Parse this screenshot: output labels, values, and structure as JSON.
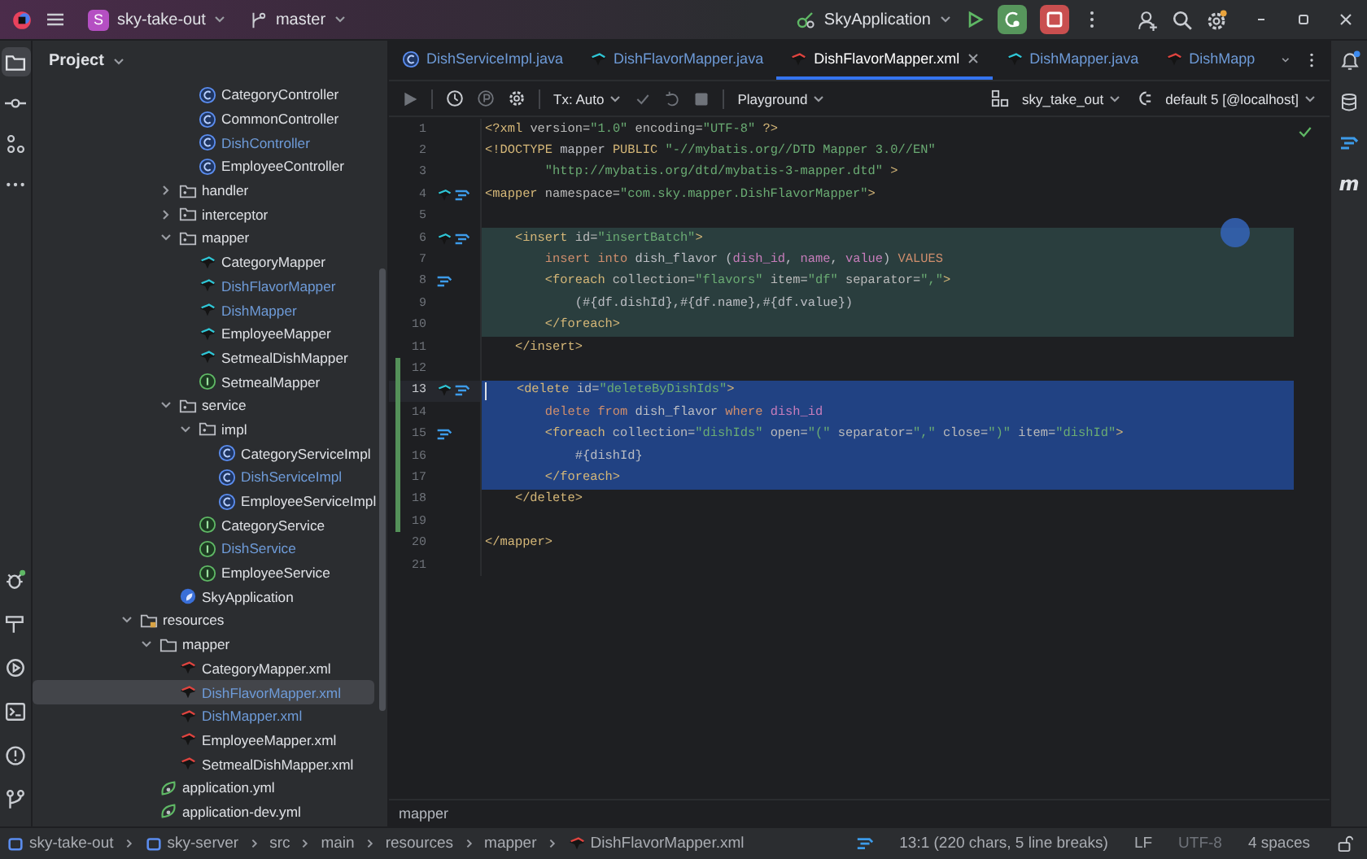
{
  "title_bar": {
    "project_badge": "S",
    "project": "sky-take-out",
    "branch": "master",
    "run_config": "SkyApplication"
  },
  "left_tools": [
    {
      "kind": "project",
      "selected": true
    },
    {
      "kind": "commit",
      "selected": false
    },
    {
      "kind": "structure",
      "selected": false
    },
    {
      "kind": "more",
      "selected": false
    }
  ],
  "left_tools_bottom": [
    {
      "kind": "debug",
      "selected": false
    },
    {
      "kind": "build",
      "selected": false
    },
    {
      "kind": "services",
      "selected": false
    },
    {
      "kind": "terminal",
      "selected": false
    },
    {
      "kind": "problems",
      "selected": false
    },
    {
      "kind": "git",
      "selected": false
    }
  ],
  "project_panel": {
    "title": "Project",
    "tree": [
      {
        "children": [
          {
            "children": [
              {
                "children": [
                  {
                    "name": "CategoryController",
                    "kind": "class",
                    "modified": false,
                    "selected": false
                  },
                  {
                    "name": "CommonController",
                    "kind": "class",
                    "modified": false,
                    "selected": false
                  },
                  {
                    "name": "DishController",
                    "kind": "class",
                    "modified": true,
                    "selected": false
                  },
                  {
                    "name": "EmployeeController",
                    "kind": "class",
                    "modified": false,
                    "selected": false
                  }
                ]
              },
              {
                "name": "handler",
                "kind": "package",
                "expanded": false,
                "modified": false,
                "selected": false
              },
              {
                "name": "interceptor",
                "kind": "package",
                "expanded": false,
                "modified": false,
                "selected": false
              },
              {
                "name": "mapper",
                "kind": "package",
                "expanded": true,
                "modified": false,
                "selected": false,
                "children": [
                  {
                    "name": "CategoryMapper",
                    "kind": "mapper",
                    "modified": false,
                    "selected": false
                  },
                  {
                    "name": "DishFlavorMapper",
                    "kind": "mapper",
                    "modified": true,
                    "selected": false
                  },
                  {
                    "name": "DishMapper",
                    "kind": "mapper",
                    "modified": true,
                    "selected": false
                  },
                  {
                    "name": "EmployeeMapper",
                    "kind": "mapper",
                    "modified": false,
                    "selected": false
                  },
                  {
                    "name": "SetmealDishMapper",
                    "kind": "mapper",
                    "modified": false,
                    "selected": false
                  },
                  {
                    "name": "SetmealMapper",
                    "kind": "interface",
                    "modified": false,
                    "selected": false
                  }
                ]
              },
              {
                "name": "service",
                "kind": "package",
                "expanded": true,
                "modified": false,
                "selected": false,
                "children": [
                  {
                    "name": "impl",
                    "kind": "package",
                    "expanded": true,
                    "modified": false,
                    "selected": false,
                    "children": [
                      {
                        "name": "CategoryServiceImpl",
                        "kind": "class",
                        "modified": false,
                        "selected": false
                      },
                      {
                        "name": "DishServiceImpl",
                        "kind": "class",
                        "modified": true,
                        "selected": false
                      },
                      {
                        "name": "EmployeeServiceImpl",
                        "kind": "class",
                        "modified": false,
                        "selected": false
                      }
                    ]
                  },
                  {
                    "name": "CategoryService",
                    "kind": "interface",
                    "modified": false,
                    "selected": false
                  },
                  {
                    "name": "DishService",
                    "kind": "interface",
                    "modified": true,
                    "selected": false
                  },
                  {
                    "name": "EmployeeService",
                    "kind": "interface",
                    "modified": false,
                    "selected": false
                  }
                ]
              },
              {
                "name": "SkyApplication",
                "kind": "app",
                "modified": false,
                "selected": false
              }
            ]
          }
        ]
      },
      {
        "name": "resources",
        "kind": "resources-folder",
        "expanded": true,
        "modified": false,
        "selected": false,
        "children": [
          {
            "name": "mapper",
            "kind": "folder",
            "expanded": true,
            "modified": false,
            "selected": false,
            "children": [
              {
                "name": "CategoryMapper.xml",
                "kind": "xml",
                "modified": false,
                "selected": false
              },
              {
                "name": "DishFlavorMapper.xml",
                "kind": "xml",
                "modified": true,
                "selected": true
              },
              {
                "name": "DishMapper.xml",
                "kind": "xml",
                "modified": true,
                "selected": false
              },
              {
                "name": "EmployeeMapper.xml",
                "kind": "xml",
                "modified": false,
                "selected": false
              },
              {
                "name": "SetmealDishMapper.xml",
                "kind": "xml",
                "modified": false,
                "selected": false
              }
            ]
          },
          {
            "name": "application.yml",
            "kind": "yml",
            "modified": false,
            "selected": false
          },
          {
            "name": "application-dev.yml",
            "kind": "yml",
            "modified": false,
            "selected": false
          }
        ]
      }
    ]
  },
  "editor": {
    "tabs": [
      {
        "name": "DishServiceImpl.java",
        "kind": "class",
        "modified": true,
        "selected": false
      },
      {
        "name": "DishFlavorMapper.java",
        "kind": "mapper",
        "modified": true,
        "selected": false
      },
      {
        "name": "DishFlavorMapper.xml",
        "kind": "xml",
        "modified": false,
        "selected": true
      },
      {
        "name": "DishMapper.java",
        "kind": "mapper",
        "modified": true,
        "selected": false
      },
      {
        "name": "DishMapp",
        "kind": "xml",
        "modified": true,
        "selected": false
      }
    ],
    "toolbar": {
      "tx": "Tx: Auto",
      "playground": "Playground",
      "schema": "sky_take_out",
      "datasource": "default 5 [@localhost]"
    },
    "lines": [
      {
        "number": "1",
        "current": false,
        "changed": false,
        "selected": false,
        "in_scope": false,
        "segments": [
          {
            "kind": "tag",
            "text": "<?xml"
          },
          {
            "kind": "attr",
            "text": " version="
          },
          {
            "kind": "str",
            "text": "\"1.0\""
          },
          {
            "kind": "attr",
            "text": " encoding="
          },
          {
            "kind": "str",
            "text": "\"UTF-8\""
          },
          {
            "kind": "tag",
            "text": " ?>"
          }
        ]
      },
      {
        "number": "2",
        "current": false,
        "changed": false,
        "selected": false,
        "in_scope": false,
        "segments": [
          {
            "kind": "tag",
            "text": "<!DOCTYPE"
          },
          {
            "kind": "txt",
            "text": " mapper "
          },
          {
            "kind": "tag",
            "text": "PUBLIC"
          },
          {
            "kind": "str",
            "text": " \"-//mybatis.org//DTD Mapper 3.0//EN\""
          }
        ]
      },
      {
        "number": "3",
        "current": false,
        "changed": false,
        "selected": false,
        "in_scope": false,
        "segments": [
          {
            "kind": "str",
            "text": "        \"http://mybatis.org/dtd/mybatis-3-mapper.dtd\""
          },
          {
            "kind": "tag",
            "text": " >"
          }
        ]
      },
      {
        "number": "4",
        "current": false,
        "changed": false,
        "selected": false,
        "in_scope": false,
        "markers": [
          {
            "kind": "mapper"
          },
          {
            "kind": "jump"
          }
        ],
        "segments": [
          {
            "kind": "tag",
            "text": "<mapper"
          },
          {
            "kind": "attr",
            "text": " namespace="
          },
          {
            "kind": "str",
            "text": "\"com.sky.mapper.DishFlavorMapper\""
          },
          {
            "kind": "tag",
            "text": ">"
          }
        ]
      },
      {
        "number": "5",
        "current": false,
        "changed": false,
        "selected": false,
        "in_scope": false
      },
      {
        "number": "6",
        "current": false,
        "changed": false,
        "selected": false,
        "in_scope": true,
        "markers": [
          {
            "kind": "mapper"
          },
          {
            "kind": "jump"
          }
        ],
        "segments": [
          {
            "kind": "tag",
            "text": "    <insert"
          },
          {
            "kind": "attr",
            "text": " id="
          },
          {
            "kind": "str",
            "text": "\"insertBatch\""
          },
          {
            "kind": "tag",
            "text": ">"
          }
        ]
      },
      {
        "number": "7",
        "current": false,
        "changed": false,
        "selected": false,
        "in_scope": true,
        "segments": [
          {
            "kind": "kw",
            "text": "        insert into"
          },
          {
            "kind": "txt",
            "text": " dish_flavor ("
          },
          {
            "kind": "col",
            "text": "dish_id"
          },
          {
            "kind": "txt",
            "text": ", "
          },
          {
            "kind": "col",
            "text": "name"
          },
          {
            "kind": "txt",
            "text": ", "
          },
          {
            "kind": "col",
            "text": "value"
          },
          {
            "kind": "txt",
            "text": ") "
          },
          {
            "kind": "kw",
            "text": "VALUES"
          }
        ]
      },
      {
        "number": "8",
        "current": false,
        "changed": false,
        "selected": false,
        "in_scope": true,
        "markers": [
          {
            "kind": "jump"
          }
        ],
        "segments": [
          {
            "kind": "tag",
            "text": "        <foreach"
          },
          {
            "kind": "attr",
            "text": " collection="
          },
          {
            "kind": "str",
            "text": "\"flavors\""
          },
          {
            "kind": "attr",
            "text": " item="
          },
          {
            "kind": "str",
            "text": "\"df\""
          },
          {
            "kind": "attr",
            "text": " separator="
          },
          {
            "kind": "str",
            "text": "\",\""
          },
          {
            "kind": "tag",
            "text": ">"
          }
        ]
      },
      {
        "number": "9",
        "current": false,
        "changed": false,
        "selected": false,
        "in_scope": true,
        "segments": [
          {
            "kind": "txt",
            "text": "            (#{df.dishId},#{df.name},#{df.value})"
          }
        ]
      },
      {
        "number": "10",
        "current": false,
        "changed": false,
        "selected": false,
        "in_scope": true,
        "segments": [
          {
            "kind": "tag",
            "text": "        </foreach>"
          }
        ]
      },
      {
        "number": "11",
        "current": false,
        "changed": false,
        "selected": false,
        "in_scope": false,
        "segments": [
          {
            "kind": "tag",
            "text": "    </insert>"
          }
        ]
      },
      {
        "number": "12",
        "current": false,
        "changed": true,
        "selected": false,
        "in_scope": false
      },
      {
        "number": "13",
        "current": true,
        "changed": true,
        "selected": true,
        "in_scope": false,
        "markers": [
          {
            "kind": "mapper"
          },
          {
            "kind": "jump"
          }
        ],
        "segments": [
          {
            "kind": "tag",
            "text": "    <delete"
          },
          {
            "kind": "attr",
            "text": " id="
          },
          {
            "kind": "str",
            "text": "\"deleteByDishIds\""
          },
          {
            "kind": "tag",
            "text": ">"
          }
        ]
      },
      {
        "number": "14",
        "current": false,
        "changed": true,
        "selected": true,
        "in_scope": false,
        "segments": [
          {
            "kind": "kw",
            "text": "        delete from"
          },
          {
            "kind": "txt",
            "text": " dish_flavor "
          },
          {
            "kind": "kw",
            "text": "where "
          },
          {
            "kind": "col",
            "text": "dish_id"
          }
        ]
      },
      {
        "number": "15",
        "current": false,
        "changed": true,
        "selected": true,
        "in_scope": false,
        "markers": [
          {
            "kind": "jump"
          }
        ],
        "segments": [
          {
            "kind": "tag",
            "text": "        <foreach"
          },
          {
            "kind": "attr",
            "text": " collection="
          },
          {
            "kind": "str",
            "text": "\"dishIds\""
          },
          {
            "kind": "attr",
            "text": " open="
          },
          {
            "kind": "str",
            "text": "\"(\""
          },
          {
            "kind": "attr",
            "text": " separator="
          },
          {
            "kind": "str",
            "text": "\",\""
          },
          {
            "kind": "attr",
            "text": " close="
          },
          {
            "kind": "str",
            "text": "\")\""
          },
          {
            "kind": "attr",
            "text": " item="
          },
          {
            "kind": "str",
            "text": "\"dishId\""
          },
          {
            "kind": "tag",
            "text": ">"
          }
        ]
      },
      {
        "number": "16",
        "current": false,
        "changed": true,
        "selected": true,
        "in_scope": false,
        "segments": [
          {
            "kind": "txt",
            "text": "            #{dishId}"
          }
        ]
      },
      {
        "number": "17",
        "current": false,
        "changed": true,
        "selected": true,
        "in_scope": false,
        "segments": [
          {
            "kind": "tag",
            "text": "        </foreach>"
          }
        ]
      },
      {
        "number": "18",
        "current": false,
        "changed": true,
        "selected": false,
        "in_scope": false,
        "segments": [
          {
            "kind": "tag",
            "text": "    </delete>"
          }
        ]
      },
      {
        "number": "19",
        "current": false,
        "changed": true,
        "selected": false,
        "in_scope": false
      },
      {
        "number": "20",
        "current": false,
        "changed": false,
        "selected": false,
        "in_scope": false,
        "segments": [
          {
            "kind": "tag",
            "text": "</mapper>"
          }
        ]
      },
      {
        "number": "21",
        "current": false,
        "changed": false,
        "selected": false,
        "in_scope": false
      }
    ],
    "breadcrumb": "mapper"
  },
  "right_tools": [
    {
      "kind": "notifications"
    },
    {
      "kind": "database"
    },
    {
      "kind": "mybatis"
    },
    {
      "kind": "maven",
      "glyph": "m"
    }
  ],
  "status_bar": {
    "path": [
      {
        "kind": "module",
        "label": "sky-take-out"
      },
      {
        "kind": "module",
        "label": "sky-server"
      },
      {
        "kind": "plain",
        "label": "src"
      },
      {
        "kind": "plain",
        "label": "main"
      },
      {
        "kind": "plain",
        "label": "resources"
      },
      {
        "kind": "plain",
        "label": "mapper"
      },
      {
        "kind": "xml",
        "label": "DishFlavorMapper.xml"
      }
    ],
    "position": "13:1 (220 chars, 5 line breaks)",
    "line_separator": "LF",
    "encoding": {
      "text": "UTF-8",
      "disabled": true
    },
    "indent": "4 spaces"
  }
}
